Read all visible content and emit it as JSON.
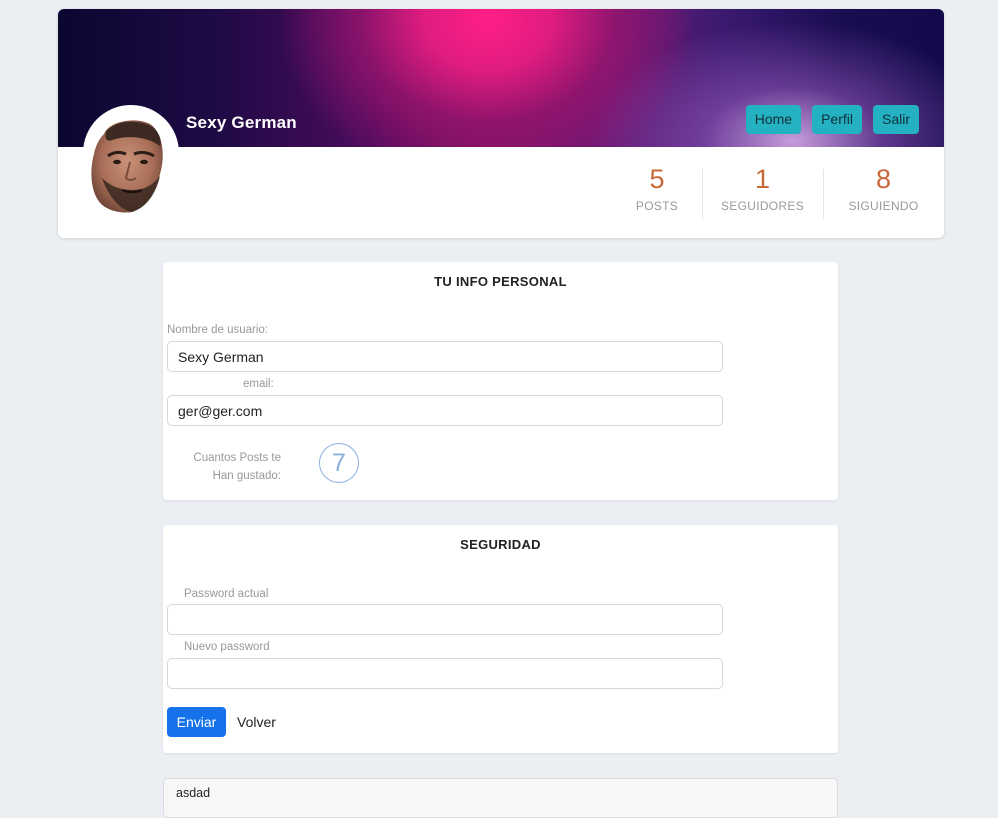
{
  "profile": {
    "name": "Sexy German",
    "avatar_alt": "avatar"
  },
  "nav": {
    "home": "Home",
    "perfil": "Perfil",
    "salir": "Salir"
  },
  "stats": [
    {
      "value": "5",
      "label": "POSTS"
    },
    {
      "value": "1",
      "label": "SEGUIDORES"
    },
    {
      "value": "8",
      "label": "SIGUIENDO"
    }
  ],
  "personal_info": {
    "title": "TU INFO PERSONAL",
    "username_label": "Nombre de usuario:",
    "username_value": "Sexy German",
    "email_label": "email:",
    "email_value": "ger@ger.com",
    "likes_label_line1": "Cuantos Posts te",
    "likes_label_line2": "Han gustado:",
    "likes_count": "7"
  },
  "security": {
    "title": "SEGURIDAD",
    "current_password_label": "Password actual",
    "current_password_value": "",
    "new_password_label": "Nuevo password",
    "new_password_value": "",
    "submit_label": "Enviar",
    "back_label": "Volver"
  },
  "posts": [
    {
      "text": "asdad"
    }
  ],
  "colors": {
    "background": "#ebeef2",
    "nav_button": "#24b2c2",
    "stat_number": "#c8693a",
    "primary_button": "#1672ea",
    "likes_circle": "#8ab0de"
  }
}
